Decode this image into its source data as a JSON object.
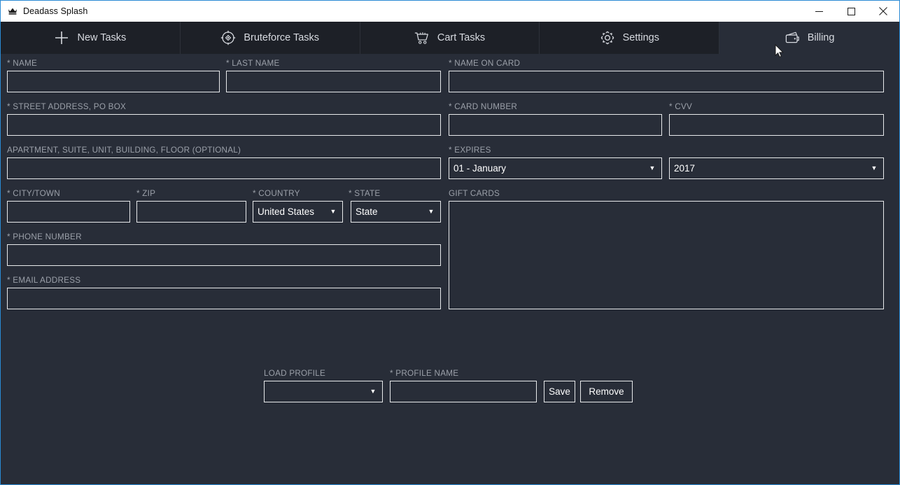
{
  "window": {
    "title": "Deadass Splash",
    "icon": "crown-icon",
    "controls": [
      {
        "name": "minimize-button",
        "glyph": "minimize-icon"
      },
      {
        "name": "maximize-button",
        "glyph": "maximize-icon"
      },
      {
        "name": "close-button",
        "glyph": "close-icon"
      }
    ],
    "accent_color": "#2a8ad4",
    "body_background": "#282d38",
    "tabbar_background": "#1d2027"
  },
  "tabs": [
    {
      "label": "New Tasks",
      "icon": "plus-icon",
      "active": false
    },
    {
      "label": "Bruteforce Tasks",
      "icon": "target-icon",
      "active": false
    },
    {
      "label": "Cart Tasks",
      "icon": "shopping-cart-icon",
      "active": false
    },
    {
      "label": "Settings",
      "icon": "gear-icon",
      "active": false
    },
    {
      "label": "Billing",
      "icon": "wallet-icon",
      "active": true
    }
  ],
  "form": {
    "name": {
      "label": "* NAME",
      "value": "",
      "placeholder": ""
    },
    "last_name": {
      "label": "* LAST NAME",
      "value": "",
      "placeholder": ""
    },
    "name_on_card": {
      "label": "* NAME ON CARD",
      "value": "",
      "placeholder": ""
    },
    "street_address": {
      "label": "* STREET ADDRESS, PO BOX",
      "value": "",
      "placeholder": ""
    },
    "card_number": {
      "label": "* CARD NUMBER",
      "value": "",
      "placeholder": ""
    },
    "cvv": {
      "label": "* CVV",
      "value": "",
      "placeholder": ""
    },
    "apartment": {
      "label": "APARTMENT, SUITE, UNIT, BUILDING, FLOOR (OPTIONAL)",
      "value": "",
      "placeholder": ""
    },
    "expires": {
      "label": "* EXPIRES",
      "month": {
        "value": "01 - January",
        "arrow": "▼"
      },
      "year": {
        "value": "2017",
        "arrow": "▼"
      }
    },
    "city": {
      "label": "* CITY/TOWN",
      "value": "",
      "placeholder": ""
    },
    "zip": {
      "label": "* ZIP",
      "value": "",
      "placeholder": ""
    },
    "country": {
      "label": "* COUNTRY",
      "value": "United States",
      "arrow": "▼"
    },
    "state": {
      "label": "* STATE",
      "value": "State",
      "arrow": "▼"
    },
    "gift_cards": {
      "label": "GIFT CARDS",
      "value": "",
      "placeholder": ""
    },
    "phone": {
      "label": "* PHONE NUMBER",
      "value": "",
      "placeholder": ""
    },
    "email": {
      "label": "* EMAIL ADDRESS",
      "value": "",
      "placeholder": ""
    }
  },
  "profile": {
    "load_profile": {
      "label": "LOAD PROFILE",
      "value": "",
      "arrow": "▼"
    },
    "profile_name": {
      "label": "* PROFILE NAME",
      "value": "",
      "placeholder": ""
    },
    "save_label": "Save",
    "remove_label": "Remove"
  }
}
